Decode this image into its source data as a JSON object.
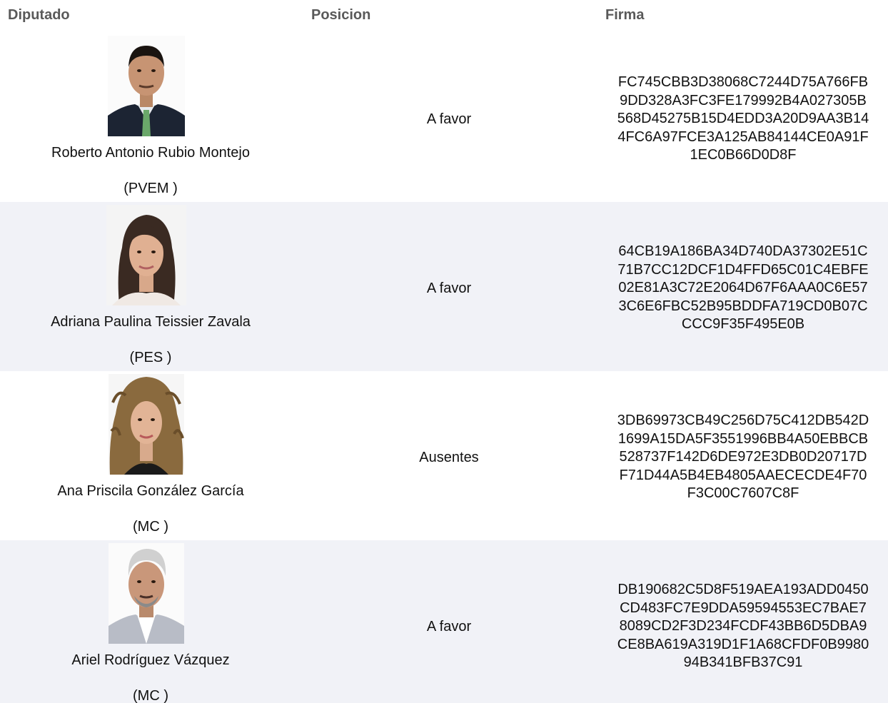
{
  "headers": {
    "diputado": "Diputado",
    "posicion": "Posicion",
    "firma": "Firma"
  },
  "rows": [
    {
      "name": "Roberto Antonio Rubio Montejo",
      "party": "(PVEM )",
      "position": "A favor",
      "signature_lines": [
        "FC745CBB3D38068C7244D75A766FB",
        "9DD328A3FC3FE179992B4A027305B",
        "568D45275B15D4EDD3A20D9AA3B14",
        "4FC6A97FCE3A125AB84144CE0A91F",
        "1EC0B66D0D8F"
      ]
    },
    {
      "name": "Adriana Paulina Teissier Zavala",
      "party": "(PES )",
      "position": "A favor",
      "signature_lines": [
        "64CB19A186BA34D740DA37302E51C",
        "71B7CC12DCF1D4FFD65C01C4EBFE",
        "02E81A3C72E2064D67F6AAA0C6E57",
        "3C6E6FBC52B95BDDFA719CD0B07C",
        "CCC9F35F495E0B"
      ]
    },
    {
      "name": "Ana Priscila González García",
      "party": "(MC )",
      "position": "Ausentes",
      "signature_lines": [
        "3DB69973CB49C256D75C412DB542D",
        "1699A15DA5F3551996BB4A50EBBCB",
        "528737F142D6DE972E3DB0D20717D",
        "F71D44A5B4EB4805AAECECDE4F70",
        "F3C00C7607C8F"
      ]
    },
    {
      "name": "Ariel Rodríguez Vázquez",
      "party": "(MC )",
      "position": "A favor",
      "signature_lines": [
        "DB190682C5D8F519AEA193ADD0450",
        "CD483FC7E9DDA59594553EC7BAE7",
        "8089CD2F3D234FCDF43BB6D5DBA9",
        "CE8BA619A319D1F1A68CFDF0B9980",
        "94B341BFB37C91"
      ]
    }
  ]
}
